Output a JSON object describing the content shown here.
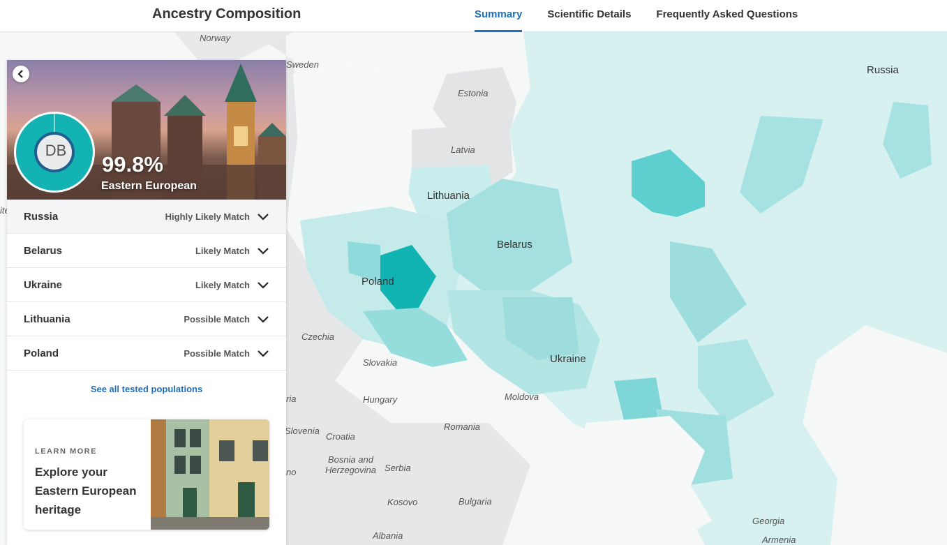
{
  "header": {
    "title": "Ancestry Composition",
    "tabs": [
      {
        "label": "Summary",
        "active": true
      },
      {
        "label": "Scientific Details",
        "active": false
      },
      {
        "label": "Frequently Asked Questions",
        "active": false
      }
    ]
  },
  "panel": {
    "initials": "DB",
    "percentage": "99.8%",
    "population": "Eastern European",
    "matches": [
      {
        "country": "Russia",
        "level": "Highly Likely Match"
      },
      {
        "country": "Belarus",
        "level": "Likely Match"
      },
      {
        "country": "Ukraine",
        "level": "Likely Match"
      },
      {
        "country": "Lithuania",
        "level": "Possible Match"
      },
      {
        "country": "Poland",
        "level": "Possible Match"
      }
    ],
    "see_all": "See all tested populations",
    "learn_more": {
      "kicker": "LEARN MORE",
      "text": "Explore your Eastern European heritage"
    }
  },
  "map": {
    "labels": {
      "norway": "Norway",
      "sweden": "Sweden",
      "estonia": "Estonia",
      "latvia": "Latvia",
      "lithuania": "Lithuania",
      "belarus": "Belarus",
      "poland": "Poland",
      "russia": "Russia",
      "czechia": "Czechia",
      "slovakia": "Slovakia",
      "ukraine": "Ukraine",
      "hungary": "Hungary",
      "moldova": "Moldova",
      "romania": "Romania",
      "slovenia": "Slovenia",
      "croatia": "Croatia",
      "bosnia": "Bosnia and\nHerzegovina",
      "serbia": "Serbia",
      "kosovo": "Kosovo",
      "bulgaria": "Bulgaria",
      "albania": "Albania",
      "georgia": "Georgia",
      "armenia": "Armenia",
      "edge_ria": "ria",
      "edge_ite": "ite",
      "edge_no": "no"
    }
  },
  "colors": {
    "accent_blue": "#1f6fba",
    "teal_dark": "#0fb3b3",
    "teal_mid": "#62cfcf",
    "teal_light": "#a9e4e4",
    "teal_pale": "#d5f1f1",
    "land_gray": "#e4e5e6",
    "water": "#f7f8f8"
  }
}
